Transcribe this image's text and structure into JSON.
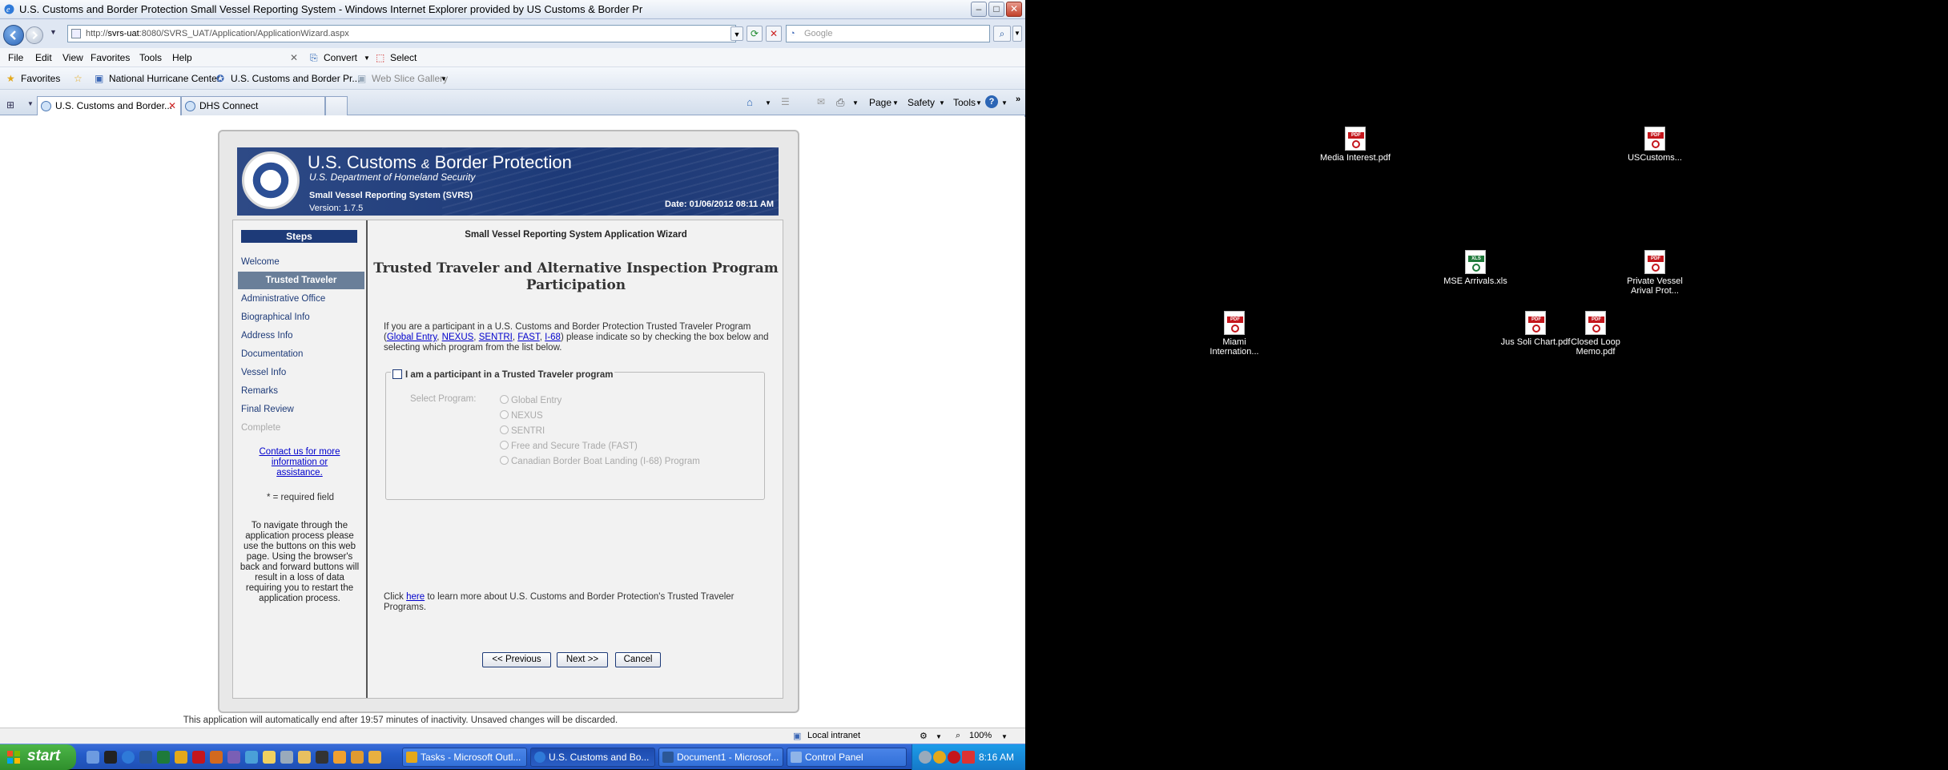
{
  "window": {
    "title": "U.S. Customs and Border Protection Small Vessel Reporting System - Windows Internet Explorer provided by US Customs & Border Pr",
    "url_prefix": "http://",
    "url_domain": "svrs-uat",
    "url_rest": ":8080/SVRS_UAT/Application/ApplicationWizard.aspx",
    "search_placeholder": "Google"
  },
  "menu": {
    "items": [
      "File",
      "Edit",
      "View",
      "Favorites",
      "Tools",
      "Help"
    ],
    "convert": "Convert",
    "select": "Select"
  },
  "favorites": {
    "label": "Favorites",
    "items": [
      "National Hurricane Center",
      "U.S. Customs and Border Pr...",
      "Web Slice Gallery"
    ]
  },
  "tabs": [
    {
      "label": "U.S. Customs and Border...",
      "active": true
    },
    {
      "label": "DHS Connect",
      "active": false
    }
  ],
  "commandbar": {
    "page": "Page",
    "safety": "Safety",
    "tools": "Tools"
  },
  "banner": {
    "title": "U.S. Customs",
    "amp": "&",
    "title2": "Border Protection",
    "subtitle": "U.S. Department of Homeland Security",
    "system": "Small Vessel Reporting System (SVRS)",
    "version": "Version: 1.7.5",
    "date": "Date: 01/06/2012 08:11 AM"
  },
  "steps": {
    "header": "Steps",
    "items": [
      {
        "label": "Welcome",
        "state": "done"
      },
      {
        "label": "Trusted Traveler",
        "state": "active"
      },
      {
        "label": "Administrative Office",
        "state": "todo"
      },
      {
        "label": "Biographical Info",
        "state": "todo"
      },
      {
        "label": "Address Info",
        "state": "todo"
      },
      {
        "label": "Documentation",
        "state": "todo"
      },
      {
        "label": "Vessel Info",
        "state": "todo"
      },
      {
        "label": "Remarks",
        "state": "todo"
      },
      {
        "label": "Final Review",
        "state": "todo"
      },
      {
        "label": "Complete",
        "state": "disabled"
      }
    ],
    "contact": "Contact us for more information or assistance.",
    "required_note": "* = required field",
    "nav_note": "To navigate through the application process please use the buttons on this web page. Using the browser's back and forward buttons will result in a loss of data requiring you to restart the application process."
  },
  "main": {
    "wizard_title": "Small Vessel Reporting System Application Wizard",
    "heading": "Trusted Traveler and Alternative Inspection Program Participation",
    "intro_before": "If you are a participant in a U.S. Customs and Border Protection Trusted Traveler Program (",
    "programs_links": [
      "Global Entry",
      "NEXUS",
      "SENTRI",
      "FAST",
      "I-68"
    ],
    "intro_after": ") please indicate so by checking the box below and selecting which program from the list below.",
    "checkbox_label": "I am a participant in a Trusted Traveler program",
    "checkbox_checked": false,
    "select_label": "Select Program:",
    "options": [
      "Global Entry",
      "NEXUS",
      "SENTRI",
      "Free and Secure Trade (FAST)",
      "Canadian Border Boat Landing (I-68) Program"
    ],
    "learn_prefix": "Click ",
    "learn_link": "here",
    "learn_suffix": " to learn more about U.S. Customs and Border Protection's Trusted Traveler Programs.",
    "prev_button": "<< Previous",
    "next_button": "Next >>",
    "cancel_button": "Cancel"
  },
  "timeout_note": "This application will automatically end after 19:57 minutes of inactivity. Unsaved changes will be discarded.",
  "statusbar": {
    "zone": "Local intranet",
    "zoom": "100%"
  },
  "desktop_icons": [
    {
      "label": "Media Interest.pdf",
      "type": "pdf"
    },
    {
      "label": "USCustoms...",
      "type": "pdf"
    },
    {
      "label": "MSE Arrivals.xls",
      "type": "xls"
    },
    {
      "label": "Private Vessel Arival Prot...",
      "type": "pdf"
    },
    {
      "label": "Miami Internation...",
      "type": "pdf"
    },
    {
      "label": "Jus Soli Chart.pdf",
      "type": "pdf"
    },
    {
      "label": "Closed Loop Memo.pdf",
      "type": "pdf"
    }
  ],
  "taskbar": {
    "start": "start",
    "tasks": [
      {
        "label": "Tasks - Microsoft Outl...",
        "active": false
      },
      {
        "label": "U.S. Customs and Bo...",
        "active": true
      },
      {
        "label": "Document1 - Microsof...",
        "active": false
      },
      {
        "label": "Control Panel",
        "active": false
      }
    ],
    "clock": "8:16 AM"
  },
  "colors": {
    "brand_navy": "#1d3a78",
    "link": "#0000cc",
    "active_step": "#6a7f99"
  }
}
